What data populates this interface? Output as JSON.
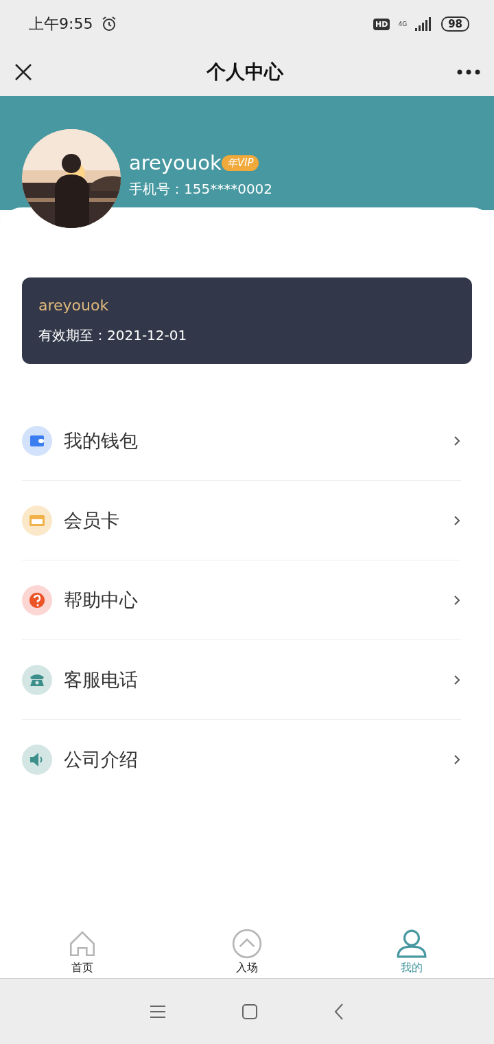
{
  "status_bar": {
    "time": "上午9:55",
    "hd": "HD",
    "network": "4G",
    "battery": "98"
  },
  "nav": {
    "title": "个人中心"
  },
  "profile": {
    "name": "areyouok",
    "badge": "年VIP",
    "phone": "手机号：155****0002"
  },
  "vip_card": {
    "name": "areyouok",
    "expiry": "有效期至：2021-12-01"
  },
  "menu": [
    {
      "kind": "wallet",
      "label": "我的钱包",
      "color": "#d3e2fb"
    },
    {
      "kind": "vip",
      "label": "会员卡",
      "color": "#fbe8c8"
    },
    {
      "kind": "help",
      "label": "帮助中心",
      "color": "#fbd6d3"
    },
    {
      "kind": "phone",
      "label": "客服电话",
      "color": "#d3e6e4"
    },
    {
      "kind": "speaker",
      "label": "公司介绍",
      "color": "#d3e6e4"
    }
  ],
  "tabs": [
    {
      "kind": "home",
      "label": "首页",
      "selected": false
    },
    {
      "kind": "enter",
      "label": "入场",
      "selected": false
    },
    {
      "kind": "me",
      "label": "我的",
      "selected": true
    }
  ]
}
